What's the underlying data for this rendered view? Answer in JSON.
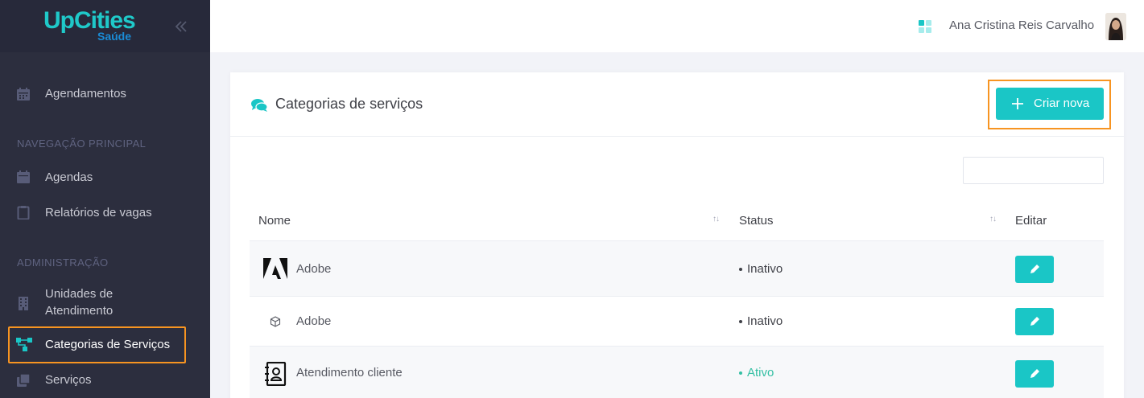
{
  "brand": {
    "name": "UpCities",
    "subtitle": "Saúde"
  },
  "sidebar": {
    "top_item": {
      "label": "Agendamentos",
      "icon": "calendar-icon"
    },
    "sections": [
      {
        "title": "NAVEGAÇÃO PRINCIPAL",
        "items": [
          {
            "label": "Agendas",
            "icon": "calendar-icon"
          },
          {
            "label": "Relatórios de vagas",
            "icon": "clipboard-icon"
          }
        ]
      },
      {
        "title": "ADMINISTRAÇÃO",
        "items": [
          {
            "label": "Unidades de Atendimento",
            "icon": "building-icon"
          },
          {
            "label": "Categorias de Serviços",
            "icon": "sitemap-icon",
            "active": true
          },
          {
            "label": "Serviços",
            "icon": "layers-icon"
          }
        ]
      }
    ]
  },
  "topbar": {
    "user_name": "Ana Cristina Reis Carvalho"
  },
  "card": {
    "title": "Categorias de serviços",
    "create_label": "Criar nova",
    "search": {
      "value": "",
      "placeholder": ""
    }
  },
  "table": {
    "columns": [
      "Nome",
      "Status",
      "Editar"
    ],
    "rows": [
      {
        "name": "Adobe",
        "status": "Inativo",
        "icon": "adobe-icon"
      },
      {
        "name": "Adobe",
        "status": "Inativo",
        "icon": "cube-icon"
      },
      {
        "name": "Atendimento cliente",
        "status": "Ativo",
        "icon": "contact-book-icon"
      }
    ]
  },
  "colors": {
    "accent": "#1ac6c6",
    "highlight": "#f79421",
    "sidebar_bg": "#2c2e3e",
    "status_active": "#34bfa3",
    "status_inactive": "#3f4047"
  }
}
